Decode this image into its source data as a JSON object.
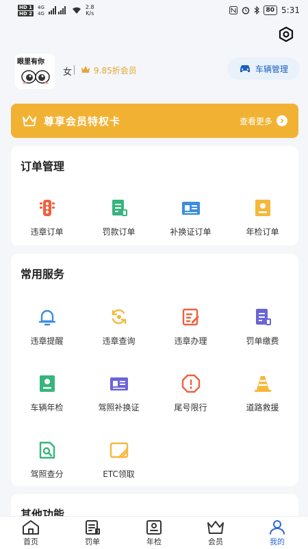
{
  "status_bar": {
    "sim1": "HD 1",
    "sim2": "HD 2",
    "net1": "4G",
    "net2": "4G",
    "speed_value": "2.8",
    "speed_unit": "K/s",
    "battery": "80",
    "time": "5:31"
  },
  "profile": {
    "avatar_text": "眼里有你",
    "gender": "女",
    "member_discount": "9.85折会员",
    "vehicle_button_label": "车辆管理"
  },
  "vip_card": {
    "title": "尊享会员特权卡",
    "see_more_label": "查看更多"
  },
  "orders": {
    "title": "订单管理",
    "items": [
      {
        "label": "违章订单",
        "icon": "traffic-light-icon",
        "color": "#f0603e"
      },
      {
        "label": "罚款订单",
        "icon": "fine-doc-icon",
        "color": "#36b57c"
      },
      {
        "label": "补换证订单",
        "icon": "id-card-icon",
        "color": "#3b8de0"
      },
      {
        "label": "年检订单",
        "icon": "inspection-icon",
        "color": "#f5b83b"
      }
    ]
  },
  "services": {
    "title": "常用服务",
    "items": [
      {
        "label": "违章提醒",
        "icon": "bell-icon",
        "color": "#3b8de0"
      },
      {
        "label": "违章查询",
        "icon": "search-refresh-icon",
        "color": "#f5b83b"
      },
      {
        "label": "违章办理",
        "icon": "edit-doc-icon",
        "color": "#f0603e"
      },
      {
        "label": "罚单缴费",
        "icon": "bill-icon",
        "color": "#6a63d9"
      },
      {
        "label": "车辆年检",
        "icon": "inspection-icon",
        "color": "#36b57c"
      },
      {
        "label": "驾照补换证",
        "icon": "license-card-icon",
        "color": "#6a63d9"
      },
      {
        "label": "尾号限行",
        "icon": "warning-octagon-icon",
        "color": "#f0603e"
      },
      {
        "label": "道路救援",
        "icon": "traffic-cone-icon",
        "color": "#f5b83b"
      },
      {
        "label": "驾照查分",
        "icon": "doc-search-icon",
        "color": "#36b57c"
      },
      {
        "label": "ETC领取",
        "icon": "etc-card-icon",
        "color": "#f5b83b"
      }
    ]
  },
  "other": {
    "title": "其他功能"
  },
  "tabbar": {
    "items": [
      {
        "label": "首页",
        "icon": "home-icon"
      },
      {
        "label": "罚单",
        "icon": "fine-icon"
      },
      {
        "label": "年检",
        "icon": "inspection-tab-icon"
      },
      {
        "label": "会员",
        "icon": "crown-tab-icon"
      },
      {
        "label": "我的",
        "icon": "profile-icon"
      }
    ],
    "active_index": 4,
    "active_color": "#2a68d6"
  }
}
